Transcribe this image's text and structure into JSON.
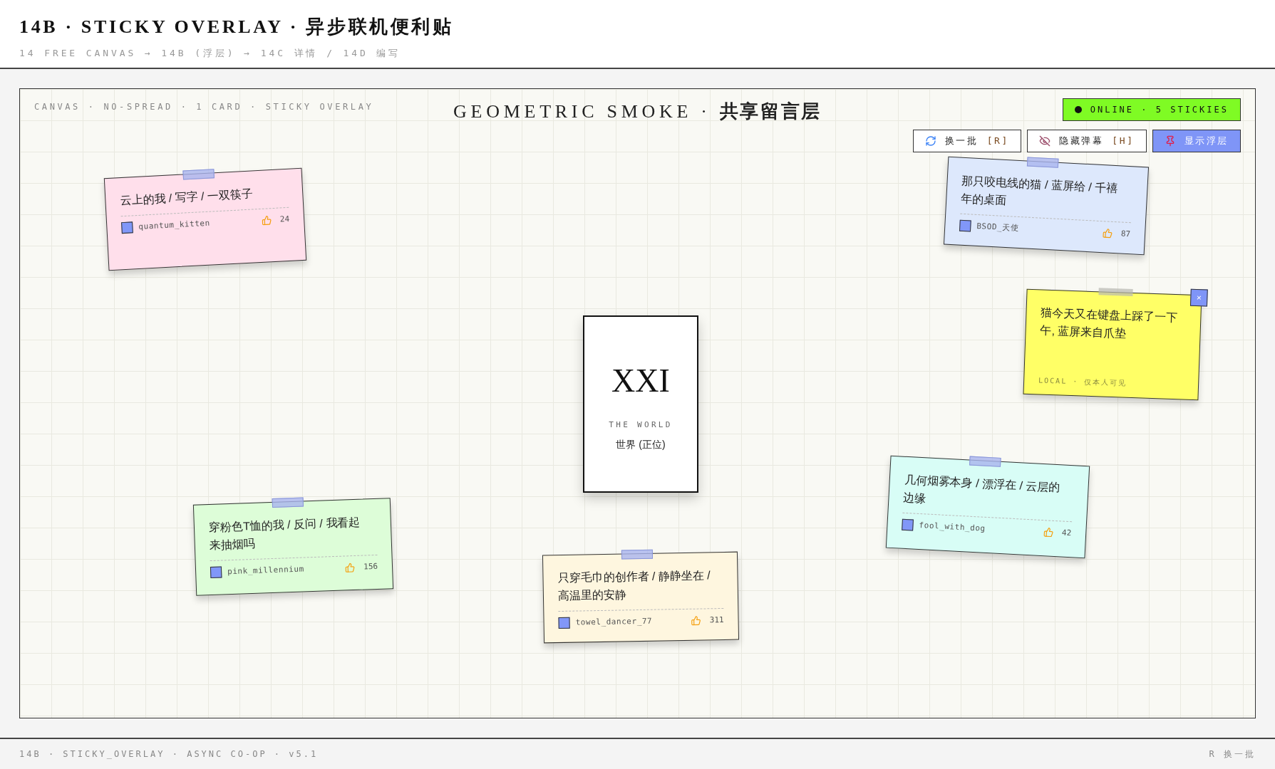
{
  "header": {
    "title": "14B · STICKY OVERLAY · 异步联机便利贴",
    "breadcrumb": "14 FREE CANVAS → 14B (浮层) → 14C 详情 / 14D 编写"
  },
  "canvas": {
    "meta": "CANVAS · NO-SPREAD · 1 CARD · STICKY OVERLAY",
    "title_latin": "GEOMETRIC SMOKE · ",
    "title_cjk": "共享留言层",
    "status": "ONLINE · 5 STICKIES",
    "buttons": [
      {
        "kind": "refresh",
        "label": "换一批",
        "key": "[R]"
      },
      {
        "kind": "hide",
        "label": "隐藏弹幕",
        "key": "[H]"
      },
      {
        "kind": "primary",
        "label": "显示浮层"
      }
    ],
    "card": {
      "numeral": "XXI",
      "name": "THE WORLD",
      "subtitle": "世界 (正位)"
    },
    "notes": [
      {
        "kind": "shared",
        "color": "#ffdfeb",
        "text": "云上的我 / 写字 / 一双筷子",
        "user": "quantum_kitten",
        "likes": "24"
      },
      {
        "kind": "shared",
        "color": "#dde8fc",
        "text": "那只咬电线的猫 / 蓝屏给 / 千禧年的桌面",
        "user": "BSOD_天使",
        "likes": "87"
      },
      {
        "kind": "local",
        "color": "#ffff66",
        "text": "猫今天又在键盘上踩了一下午, 蓝屏来自爪垫",
        "close": "×",
        "footer": "LOCAL · 仅本人可见"
      },
      {
        "kind": "shared",
        "color": "#ddfdd8",
        "text": "穿粉色T恤的我 / 反问 / 我看起来抽烟吗",
        "user": "pink_millennium",
        "likes": "156"
      },
      {
        "kind": "shared",
        "color": "#fef6df",
        "text": "只穿毛巾的创作者 / 静静坐在 / 高温里的安静",
        "user": "towel_dancer_77",
        "likes": "311"
      },
      {
        "kind": "shared",
        "color": "#d8fdf6",
        "text": "几何烟雾本身 / 漂浮在 / 云层的边缘",
        "user": "fool_with_dog",
        "likes": "42"
      }
    ]
  },
  "footer": {
    "left": "14B · STICKY_OVERLAY · ASYNC CO-OP · v5.1",
    "right": "R 换一批"
  }
}
